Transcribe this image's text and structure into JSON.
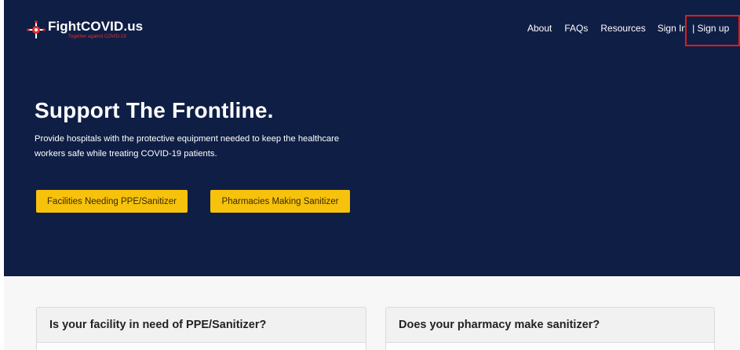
{
  "brand": {
    "name": "FightCOVID.us",
    "tagline": "Together against COVID-19",
    "icon": "virus-icon",
    "accent_color": "#e0302b"
  },
  "nav": {
    "about": "About",
    "faqs": "FAQs",
    "resources": "Resources",
    "sign_in": "Sign In",
    "sign_up": "| Sign up"
  },
  "hero": {
    "title": "Support The Frontline.",
    "subtitle": "Provide hospitals with the protective equipment needed to keep the healthcare workers safe while treating COVID-19 patients.",
    "background": "#0f1e45",
    "buttons": {
      "facilities": "Facilities Needing PPE/Sanitizer",
      "pharmacies": "Pharmacies Making Sanitizer",
      "color": "#f7c20c"
    }
  },
  "cards": {
    "facility": "Is your facility in need of PPE/Sanitizer?",
    "pharmacy": "Does your pharmacy make sanitizer?"
  }
}
